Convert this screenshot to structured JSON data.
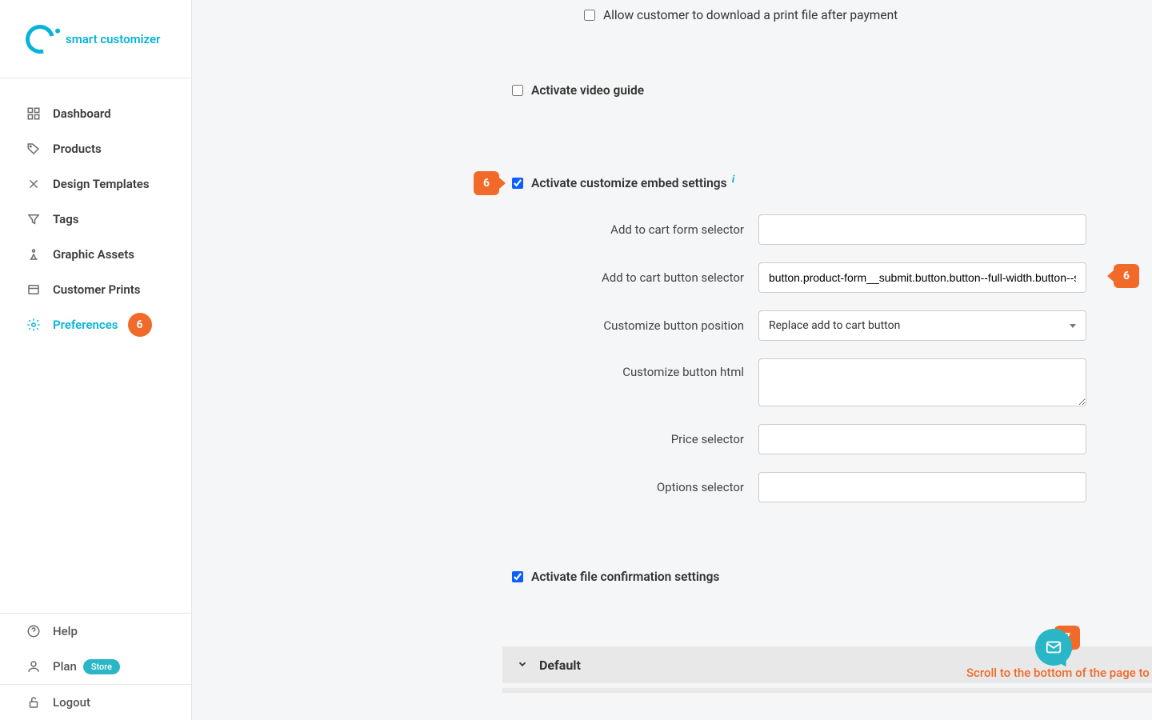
{
  "brand": "smart customizer",
  "sidebar": {
    "items": [
      {
        "label": "Dashboard"
      },
      {
        "label": "Products"
      },
      {
        "label": "Design Templates"
      },
      {
        "label": "Tags"
      },
      {
        "label": "Graphic Assets"
      },
      {
        "label": "Customer Prints"
      },
      {
        "label": "Preferences",
        "badge": "6"
      }
    ],
    "footer": {
      "help": "Help",
      "plan": "Plan",
      "plan_pill": "Store",
      "logout": "Logout"
    }
  },
  "settings": {
    "allow_download": {
      "checked": false,
      "label": "Allow customer to download a print file after payment"
    },
    "video_guide": {
      "checked": false,
      "label": "Activate video guide"
    },
    "embed": {
      "checked": true,
      "label": "Activate customize embed settings",
      "fields": {
        "form_selector": {
          "label": "Add to cart form selector",
          "value": ""
        },
        "button_selector": {
          "label": "Add to cart button selector",
          "value": "button.product-form__submit.button.button--full-width.button--s"
        },
        "button_position": {
          "label": "Customize button position",
          "value": "Replace add to cart button"
        },
        "button_html": {
          "label": "Customize button html",
          "value": ""
        },
        "price_selector": {
          "label": "Price selector",
          "value": ""
        },
        "options_selector": {
          "label": "Options selector",
          "value": ""
        }
      }
    },
    "file_confirmation": {
      "checked": true,
      "label": "Activate file confirmation settings"
    }
  },
  "accordion": {
    "default": "Default"
  },
  "hint": "Scroll to the bottom of the page to Save",
  "markers": {
    "embed": "6",
    "button_selector": "6",
    "hint": "7"
  }
}
